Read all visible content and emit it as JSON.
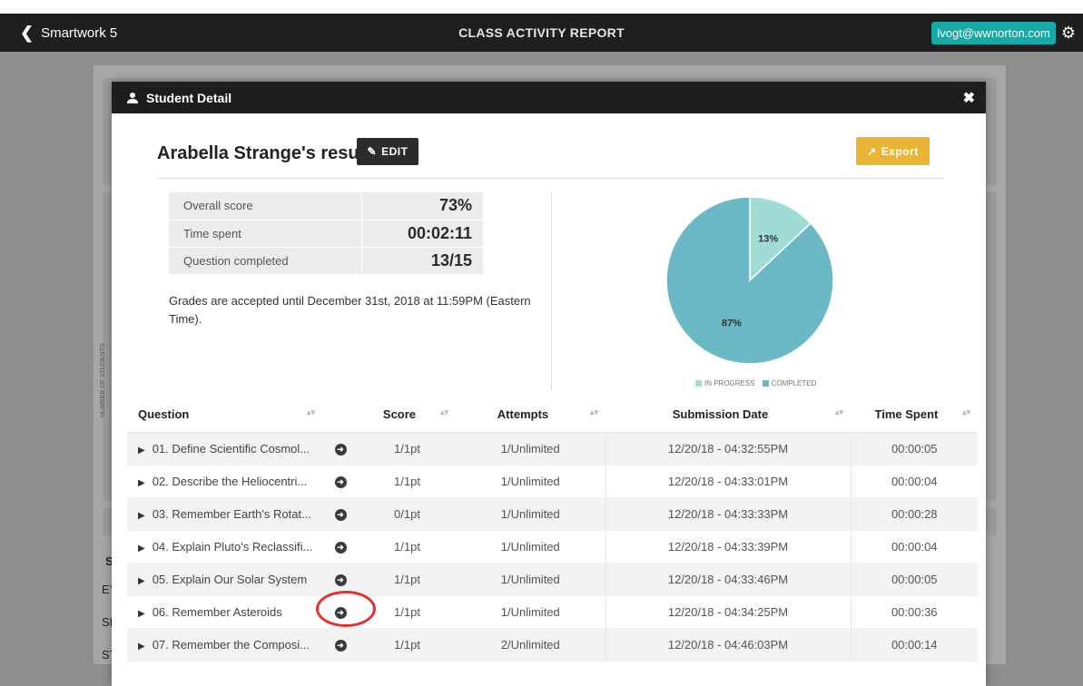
{
  "topbar": {
    "back_label": "Smartwork 5",
    "title": "CLASS ACTIVITY REPORT",
    "user_email": "lvogt@wwnorton.com"
  },
  "background": {
    "row_stubs": [
      "St",
      "EY",
      "SII",
      "ST"
    ],
    "axis_label": "NUMBER OF STUDENTS"
  },
  "modal": {
    "header_title": "Student Detail",
    "results_title": "Arabella Strange's results",
    "edit_label": "EDIT",
    "export_label": "Export",
    "scores": [
      {
        "label": "Overall score",
        "value": "73%"
      },
      {
        "label": "Time spent",
        "value": "00:02:11"
      },
      {
        "label": "Question completed",
        "value": "13/15"
      }
    ],
    "grades_note": "Grades are accepted until December 31st, 2018 at 11:59PM (Eastern Time).",
    "pie": {
      "slices": [
        {
          "label": "IN PROGRESS",
          "value": 13,
          "display": "13%",
          "color": "#9fdcd6"
        },
        {
          "label": "COMPLETED",
          "value": 87,
          "display": "87%",
          "color": "#6bb9c6"
        }
      ]
    },
    "table": {
      "headers": [
        "Question",
        "Score",
        "Attempts",
        "Submission Date",
        "Time Spent"
      ],
      "rows": [
        {
          "question": "01. Define Scientific Cosmol...",
          "score": "1/1pt",
          "attempts": "1/Unlimited",
          "date": "12/20/18 - 04:32:55PM",
          "time": "00:00:05"
        },
        {
          "question": "02. Describe the Heliocentri...",
          "score": "1/1pt",
          "attempts": "1/Unlimited",
          "date": "12/20/18 - 04:33:01PM",
          "time": "00:00:04"
        },
        {
          "question": "03. Remember Earth's Rotat...",
          "score": "0/1pt",
          "attempts": "1/Unlimited",
          "date": "12/20/18 - 04:33:33PM",
          "time": "00:00:28"
        },
        {
          "question": "04. Explain Pluto's Reclassifi...",
          "score": "1/1pt",
          "attempts": "1/Unlimited",
          "date": "12/20/18 - 04:33:39PM",
          "time": "00:00:04"
        },
        {
          "question": "05. Explain Our Solar System",
          "score": "1/1pt",
          "attempts": "1/Unlimited",
          "date": "12/20/18 - 04:33:46PM",
          "time": "00:00:05"
        },
        {
          "question": "06. Remember Asteroids",
          "score": "1/1pt",
          "attempts": "1/Unlimited",
          "date": "12/20/18 - 04:34:25PM",
          "time": "00:00:36"
        },
        {
          "question": "07. Remember the Composi...",
          "score": "1/1pt",
          "attempts": "2/Unlimited",
          "date": "12/20/18 - 04:46:03PM",
          "time": "00:00:14"
        }
      ]
    }
  },
  "colors": {
    "accent_teal": "#16a9a6",
    "export_yellow": "#e8b536",
    "highlight_red": "#e53030"
  }
}
